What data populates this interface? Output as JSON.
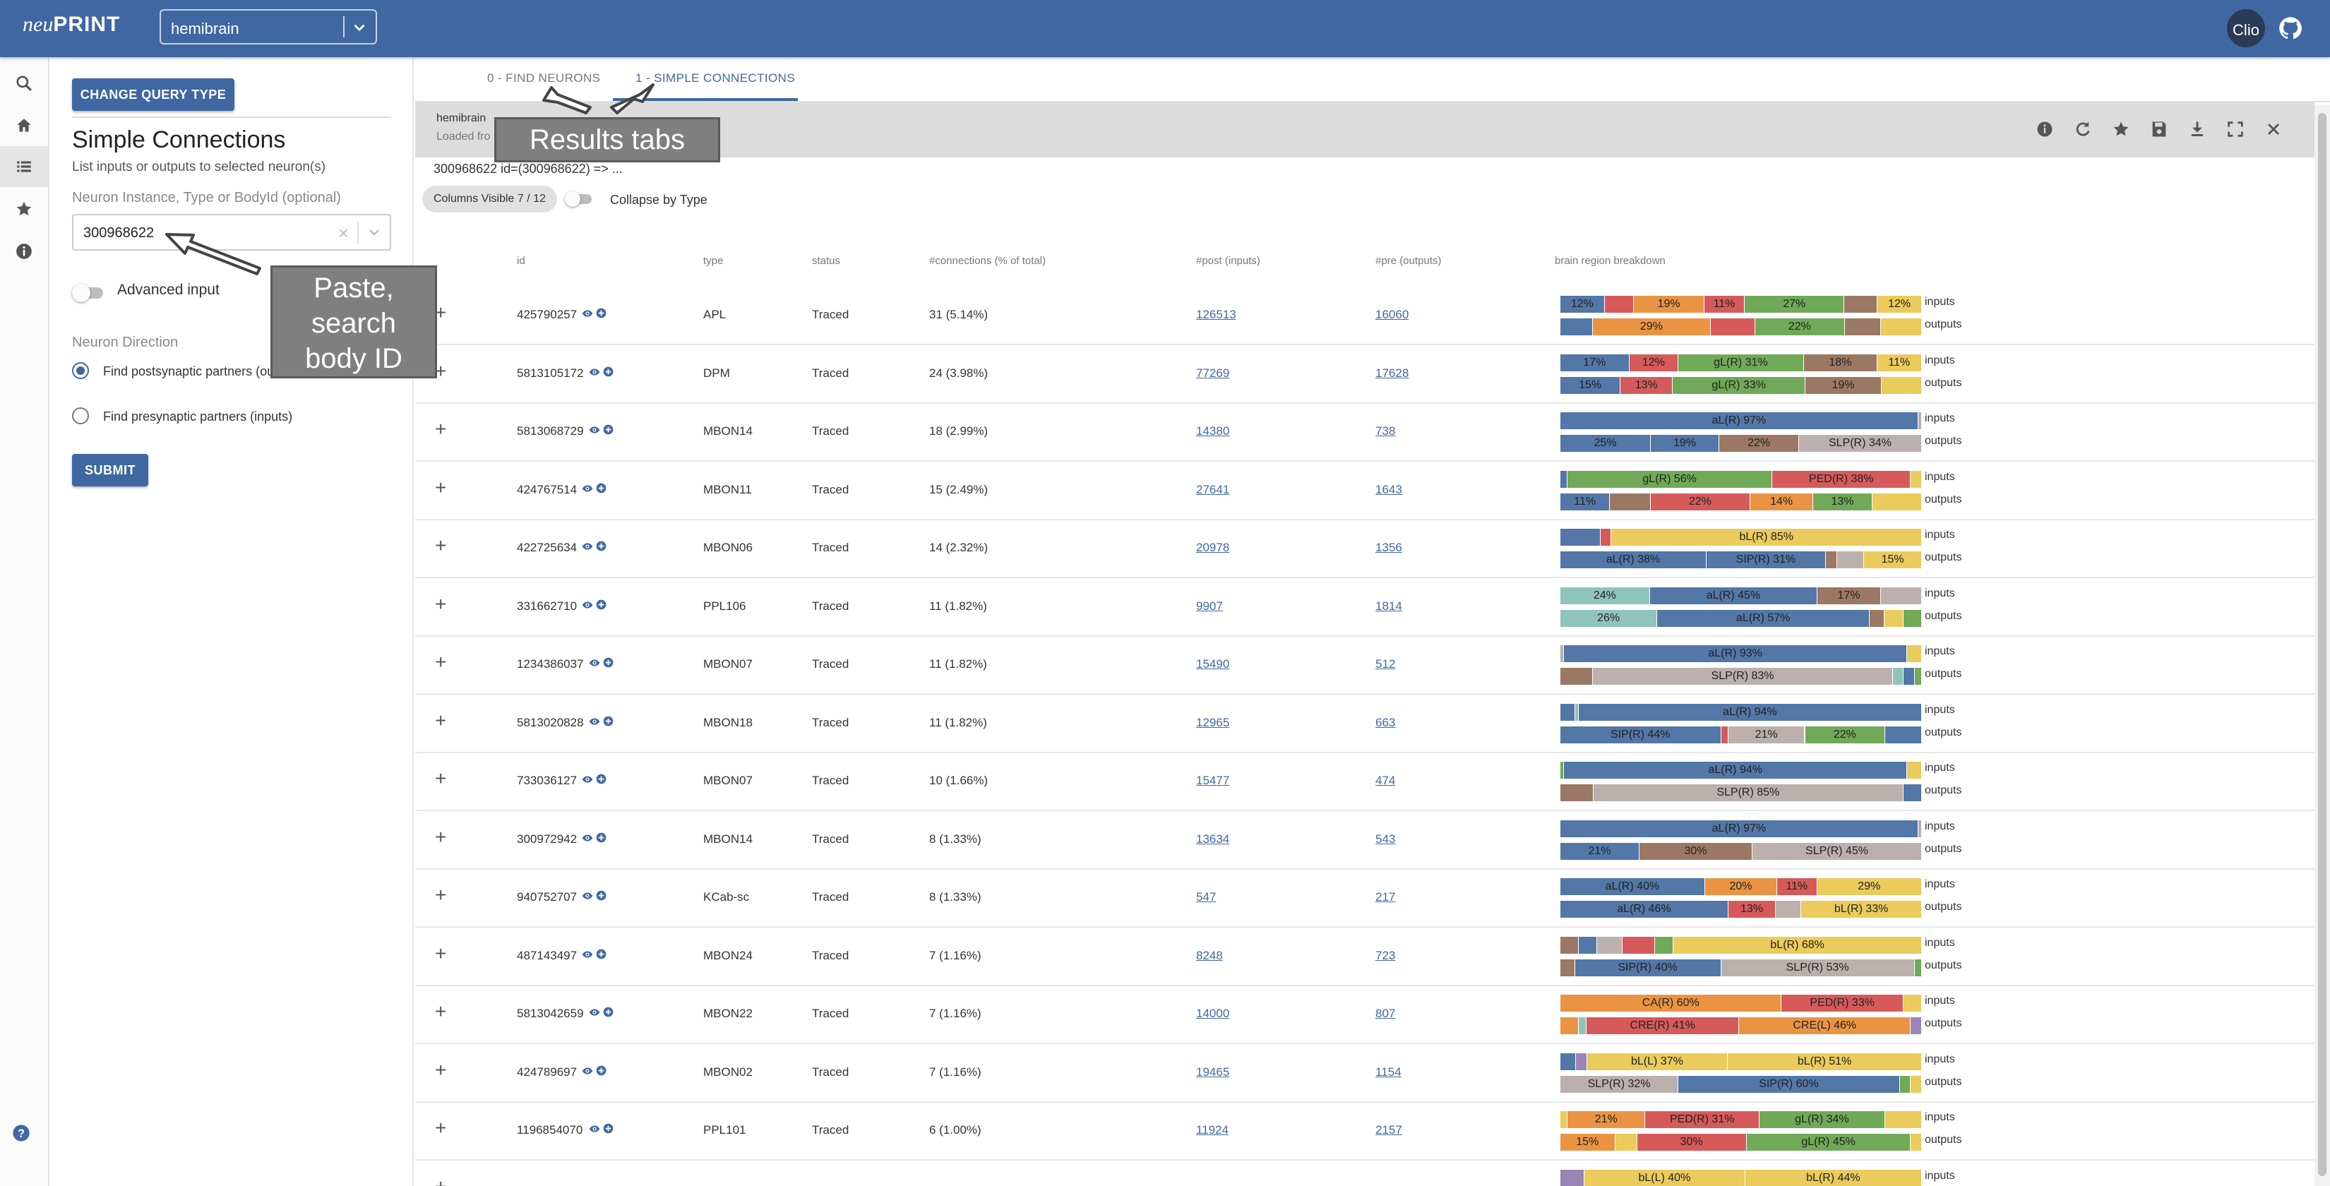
{
  "topbar": {
    "logo_neu": "neu",
    "logo_print": "PRINT",
    "dataset": "hemibrain",
    "avatar_text": "Clio"
  },
  "rail": {
    "icons": [
      "search-icon",
      "home-icon",
      "list-icon",
      "star-icon",
      "info-icon",
      "help-icon"
    ]
  },
  "query": {
    "change_query_type": "CHANGE QUERY TYPE",
    "title": "Simple Connections",
    "subtitle": "List inputs or outputs to selected neuron(s)",
    "neuron_field_label": "Neuron Instance, Type or BodyId (optional)",
    "neuron_value": "300968622",
    "advanced_input": "Advanced input",
    "direction_label": "Neuron Direction",
    "option_post": "Find postsynaptic partners (outputs)",
    "option_pre": "Find presynaptic partners (inputs)",
    "submit": "SUBMIT"
  },
  "results": {
    "tabs": [
      {
        "label": "0 - FIND NEURONS"
      },
      {
        "label": "1 - SIMPLE CONNECTIONS"
      }
    ],
    "header_dataset": "hemibrain",
    "header_loaded": "Loaded fro",
    "query_desc": "300968622 id=(300968622) => ...",
    "columns_chip": "Columns Visible 7 / 12",
    "collapse_label": "Collapse by Type",
    "columns": {
      "id": "id",
      "type": "type",
      "status": "status",
      "connections": "#connections (% of total)",
      "post": "#post (inputs)",
      "pre": "#pre (outputs)",
      "breakdown": "brain region breakdown"
    },
    "bar_label_in": "inputs",
    "bar_label_out": "outputs"
  },
  "colors": {
    "blue": "#5377a7",
    "red": "#d65a5a",
    "orange": "#ea9443",
    "green": "#70a957",
    "brown": "#9b7863",
    "grey": "#bbb0ad",
    "yellow": "#eacb5c",
    "teal": "#8fc4bc",
    "purple": "#9a86b6",
    "pink": "#eba0ac"
  },
  "rows": [
    {
      "id": "425790257",
      "type": "APL",
      "status": "Traced",
      "connections": "31 (5.14%)",
      "post": "126513",
      "pre": "16060",
      "inputs": [
        [
          "blue",
          12,
          "12%"
        ],
        [
          "red",
          8,
          ""
        ],
        [
          "orange",
          19,
          "19%"
        ],
        [
          "red",
          11,
          "11%"
        ],
        [
          "green",
          27,
          "27%"
        ],
        [
          "brown",
          9,
          ""
        ],
        [
          "yellow",
          12,
          "12%"
        ]
      ],
      "outputs": [
        [
          "blue",
          8,
          ""
        ],
        [
          "orange",
          29,
          "29%"
        ],
        [
          "red",
          11,
          ""
        ],
        [
          "green",
          22,
          "22%"
        ],
        [
          "brown",
          9,
          ""
        ],
        [
          "yellow",
          10,
          ""
        ]
      ]
    },
    {
      "id": "5813105172",
      "type": "DPM",
      "status": "Traced",
      "connections": "24 (3.98%)",
      "post": "77269",
      "pre": "17628",
      "inputs": [
        [
          "blue",
          17,
          "17%"
        ],
        [
          "red",
          12,
          "12%"
        ],
        [
          "green",
          31,
          "gL(R) 31%"
        ],
        [
          "brown",
          18,
          "18%"
        ],
        [
          "yellow",
          11,
          "11%"
        ]
      ],
      "outputs": [
        [
          "blue",
          15,
          "15%"
        ],
        [
          "red",
          13,
          "13%"
        ],
        [
          "green",
          33,
          "gL(R) 33%"
        ],
        [
          "brown",
          19,
          "19%"
        ],
        [
          "yellow",
          10,
          ""
        ]
      ]
    },
    {
      "id": "5813068729",
      "type": "MBON14",
      "status": "Traced",
      "connections": "18 (2.99%)",
      "post": "14380",
      "pre": "738",
      "inputs": [
        [
          "blue",
          97,
          "aL(R) 97%"
        ],
        [
          "grey",
          1,
          ""
        ]
      ],
      "outputs": [
        [
          "blue",
          25,
          "25%"
        ],
        [
          "blue",
          19,
          "19%"
        ],
        [
          "brown",
          22,
          "22%"
        ],
        [
          "grey",
          34,
          "SLP(R) 34%"
        ]
      ]
    },
    {
      "id": "424767514",
      "type": "MBON11",
      "status": "Traced",
      "connections": "15 (2.49%)",
      "post": "27641",
      "pre": "1643",
      "inputs": [
        [
          "blue",
          2,
          ""
        ],
        [
          "green",
          56,
          "gL(R) 56%"
        ],
        [
          "red",
          38,
          "PED(R) 38%"
        ],
        [
          "yellow",
          3,
          ""
        ]
      ],
      "outputs": [
        [
          "blue",
          11,
          "11%"
        ],
        [
          "brown",
          9,
          ""
        ],
        [
          "red",
          22,
          "22%"
        ],
        [
          "orange",
          14,
          "14%"
        ],
        [
          "green",
          13,
          "13%"
        ],
        [
          "yellow",
          11,
          ""
        ]
      ]
    },
    {
      "id": "422725634",
      "type": "MBON06",
      "status": "Traced",
      "connections": "14 (2.32%)",
      "post": "20978",
      "pre": "1356",
      "inputs": [
        [
          "blue",
          11,
          ""
        ],
        [
          "red",
          3,
          ""
        ],
        [
          "yellow",
          85,
          "bL(R) 85%"
        ]
      ],
      "outputs": [
        [
          "blue",
          38,
          "aL(R) 38%"
        ],
        [
          "blue",
          31,
          "SIP(R) 31%"
        ],
        [
          "brown",
          3,
          ""
        ],
        [
          "grey",
          7,
          ""
        ],
        [
          "yellow",
          15,
          "15%"
        ]
      ]
    },
    {
      "id": "331662710",
      "type": "PPL106",
      "status": "Traced",
      "connections": "11 (1.82%)",
      "post": "9907",
      "pre": "1814",
      "inputs": [
        [
          "teal",
          24,
          "24%"
        ],
        [
          "blue",
          45,
          "aL(R) 45%"
        ],
        [
          "brown",
          17,
          "17%"
        ],
        [
          "grey",
          11,
          ""
        ]
      ],
      "outputs": [
        [
          "teal",
          26,
          "26%"
        ],
        [
          "blue",
          57,
          "aL(R) 57%"
        ],
        [
          "brown",
          4,
          ""
        ],
        [
          "yellow",
          5,
          ""
        ],
        [
          "green",
          5,
          ""
        ]
      ]
    },
    {
      "id": "1234386037",
      "type": "MBON07",
      "status": "Traced",
      "connections": "11 (1.82%)",
      "post": "15490",
      "pre": "512",
      "inputs": [
        [
          "grey",
          1,
          ""
        ],
        [
          "blue",
          93,
          "aL(R) 93%"
        ],
        [
          "yellow",
          4,
          ""
        ]
      ],
      "outputs": [
        [
          "brown",
          9,
          ""
        ],
        [
          "grey",
          83,
          "SLP(R) 83%"
        ],
        [
          "teal",
          3,
          ""
        ],
        [
          "blue",
          3,
          ""
        ],
        [
          "green",
          2,
          ""
        ]
      ]
    },
    {
      "id": "5813020828",
      "type": "MBON18",
      "status": "Traced",
      "connections": "11 (1.82%)",
      "post": "12965",
      "pre": "663",
      "inputs": [
        [
          "blue",
          4,
          ""
        ],
        [
          "teal",
          1,
          ""
        ],
        [
          "blue",
          94,
          "aL(R) 94%"
        ]
      ],
      "outputs": [
        [
          "blue",
          44,
          "SIP(R) 44%"
        ],
        [
          "red",
          2,
          ""
        ],
        [
          "grey",
          21,
          "21%"
        ],
        [
          "green",
          22,
          "22%"
        ],
        [
          "blue",
          10,
          ""
        ]
      ]
    },
    {
      "id": "733036127",
      "type": "MBON07",
      "status": "Traced",
      "connections": "10 (1.66%)",
      "post": "15477",
      "pre": "474",
      "inputs": [
        [
          "green",
          1,
          ""
        ],
        [
          "blue",
          94,
          "aL(R) 94%"
        ],
        [
          "yellow",
          4,
          ""
        ]
      ],
      "outputs": [
        [
          "brown",
          9,
          ""
        ],
        [
          "grey",
          85,
          "SLP(R) 85%"
        ],
        [
          "blue",
          5,
          ""
        ]
      ]
    },
    {
      "id": "300972942",
      "type": "MBON14",
      "status": "Traced",
      "connections": "8 (1.33%)",
      "post": "13634",
      "pre": "543",
      "inputs": [
        [
          "blue",
          97,
          "aL(R) 97%"
        ],
        [
          "grey",
          1,
          ""
        ]
      ],
      "outputs": [
        [
          "blue",
          21,
          "21%"
        ],
        [
          "brown",
          30,
          "30%"
        ],
        [
          "grey",
          45,
          "SLP(R) 45%"
        ]
      ]
    },
    {
      "id": "940752707",
      "type": "KCab-sc",
      "status": "Traced",
      "connections": "8 (1.33%)",
      "post": "547",
      "pre": "217",
      "inputs": [
        [
          "blue",
          40,
          "aL(R) 40%"
        ],
        [
          "orange",
          20,
          "20%"
        ],
        [
          "red",
          11,
          "11%"
        ],
        [
          "yellow",
          29,
          "29%"
        ]
      ],
      "outputs": [
        [
          "blue",
          46,
          "aL(R) 46%"
        ],
        [
          "red",
          13,
          "13%"
        ],
        [
          "grey",
          7,
          ""
        ],
        [
          "yellow",
          33,
          "bL(R) 33%"
        ]
      ]
    },
    {
      "id": "487143497",
      "type": "MBON24",
      "status": "Traced",
      "connections": "7 (1.16%)",
      "post": "8248",
      "pre": "723",
      "inputs": [
        [
          "brown",
          5,
          ""
        ],
        [
          "blue",
          5,
          ""
        ],
        [
          "grey",
          7,
          ""
        ],
        [
          "red",
          9,
          ""
        ],
        [
          "green",
          5,
          ""
        ],
        [
          "yellow",
          68,
          "bL(R) 68%"
        ]
      ],
      "outputs": [
        [
          "brown",
          4,
          ""
        ],
        [
          "blue",
          40,
          "SIP(R) 40%"
        ],
        [
          "grey",
          53,
          "SLP(R) 53%"
        ],
        [
          "green",
          2,
          ""
        ]
      ]
    },
    {
      "id": "5813042659",
      "type": "MBON22",
      "status": "Traced",
      "connections": "7 (1.16%)",
      "post": "14000",
      "pre": "807",
      "inputs": [
        [
          "orange",
          60,
          "CA(R) 60%"
        ],
        [
          "red",
          33,
          "PED(R) 33%"
        ],
        [
          "yellow",
          5,
          ""
        ]
      ],
      "outputs": [
        [
          "orange",
          5,
          ""
        ],
        [
          "teal",
          2,
          ""
        ],
        [
          "red",
          41,
          "CRE(R) 41%"
        ],
        [
          "orange",
          46,
          "CRE(L) 46%"
        ],
        [
          "purple",
          3,
          ""
        ]
      ]
    },
    {
      "id": "424789697",
      "type": "MBON02",
      "status": "Traced",
      "connections": "7 (1.16%)",
      "post": "19465",
      "pre": "1154",
      "inputs": [
        [
          "blue",
          4,
          ""
        ],
        [
          "purple",
          3,
          ""
        ],
        [
          "yellow",
          37,
          "bL(L) 37%"
        ],
        [
          "yellow",
          51,
          "bL(R) 51%"
        ]
      ],
      "outputs": [
        [
          "grey",
          32,
          "SLP(R) 32%"
        ],
        [
          "blue",
          60,
          "SIP(R) 60%"
        ],
        [
          "green",
          3,
          ""
        ],
        [
          "yellow",
          3,
          ""
        ]
      ]
    },
    {
      "id": "1196854070",
      "type": "PPL101",
      "status": "Traced",
      "connections": "6 (1.00%)",
      "post": "11924",
      "pre": "2157",
      "inputs": [
        [
          "yellow",
          2,
          ""
        ],
        [
          "orange",
          21,
          "21%"
        ],
        [
          "red",
          31,
          "PED(R) 31%"
        ],
        [
          "green",
          34,
          "gL(R) 34%"
        ],
        [
          "yellow",
          10,
          ""
        ]
      ],
      "outputs": [
        [
          "orange",
          15,
          "15%"
        ],
        [
          "yellow",
          6,
          ""
        ],
        [
          "red",
          30,
          "30%"
        ],
        [
          "green",
          45,
          "gL(R) 45%"
        ],
        [
          "yellow",
          3,
          ""
        ]
      ]
    },
    {
      "id": "",
      "type": "",
      "status": "",
      "connections": "",
      "post": "",
      "pre": "",
      "inputs": [
        [
          "purple",
          6,
          ""
        ],
        [
          "yellow",
          40,
          "bL(L) 40%"
        ],
        [
          "yellow",
          44,
          "bL(R) 44%"
        ]
      ],
      "outputs": []
    }
  ],
  "annotations": {
    "tabs_note": "Results tabs",
    "paste_note_1": "Paste,",
    "paste_note_2": "search",
    "paste_note_3": "body ID"
  }
}
